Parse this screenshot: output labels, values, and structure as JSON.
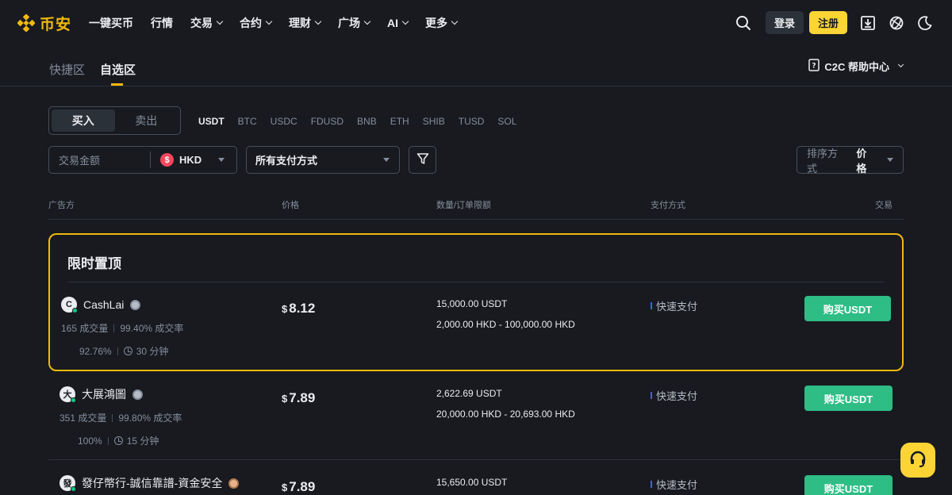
{
  "nav": {
    "brand": "币安",
    "items": [
      {
        "label": "一键买币",
        "dropdown": false
      },
      {
        "label": "行情",
        "dropdown": false
      },
      {
        "label": "交易",
        "dropdown": true
      },
      {
        "label": "合约",
        "dropdown": true
      },
      {
        "label": "理财",
        "dropdown": true
      },
      {
        "label": "广场",
        "dropdown": true
      },
      {
        "label": "AI",
        "dropdown": true
      },
      {
        "label": "更多",
        "dropdown": true
      }
    ],
    "login": "登录",
    "register": "注册"
  },
  "subtabs": {
    "quick": "快捷区",
    "p2p": "自选区",
    "help": "C2C 帮助中心"
  },
  "trade_toggle": {
    "buy": "买入",
    "sell": "卖出"
  },
  "assets": [
    "USDT",
    "BTC",
    "USDC",
    "FDUSD",
    "BNB",
    "ETH",
    "SHIB",
    "TUSD",
    "SOL"
  ],
  "selected_asset": "USDT",
  "filters": {
    "amount_placeholder": "交易金额",
    "currency": "HKD",
    "currency_symbol": "$",
    "payment": "所有支付方式",
    "sort_label": "排序方式",
    "sort_value": "价格"
  },
  "table_header": {
    "advertiser": "广告方",
    "price": "价格",
    "limit": "数量/订单限额",
    "payment": "支付方式",
    "trade": "交易"
  },
  "promo_title": "限时置顶",
  "ads": [
    {
      "avatar": "C",
      "name": "CashLai",
      "orders": "165 成交量",
      "rate": "99.40% 成交率",
      "feedback": "92.76%",
      "time": "30 分钟",
      "currency_sign": "$",
      "price": "8.12",
      "available": "15,000.00 USDT",
      "limit": "2,000.00 HKD - 100,000.00 HKD",
      "payment": "快速支付",
      "button": "购买USDT"
    },
    {
      "avatar": "大",
      "name": "大展鴻圖",
      "orders": "351 成交量",
      "rate": "99.80% 成交率",
      "feedback": "100%",
      "time": "15 分钟",
      "currency_sign": "$",
      "price": "7.89",
      "available": "2,622.69 USDT",
      "limit": "20,000.00 HKD - 20,693.00 HKD",
      "payment": "快速支付",
      "button": "购买USDT"
    },
    {
      "avatar": "發",
      "name": "發仔幣行-誠信靠譜-資金安全",
      "currency_sign": "$",
      "price": "7.89",
      "available": "15,650.00 USDT",
      "payment": "快速支付",
      "button": "购买USDT"
    }
  ],
  "colors": {
    "brand": "#F0B90B",
    "buy": "#2EBD85",
    "bg": "#181A20"
  }
}
